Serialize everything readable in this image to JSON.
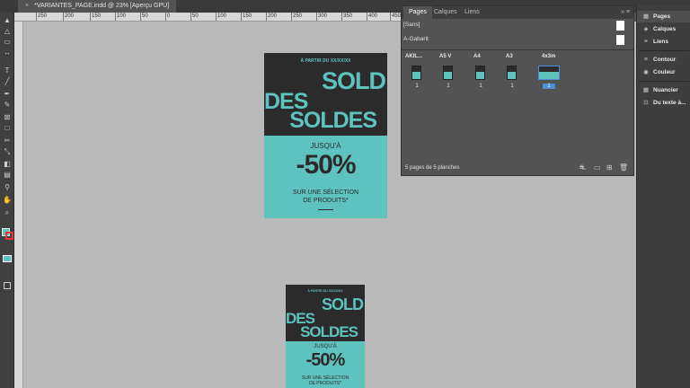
{
  "document_tab": {
    "close": "×",
    "title": "*VARIANTES_PAGE.indd @ 23% [Aperçu GPU]"
  },
  "ruler_ticks": [
    "250",
    "200",
    "150",
    "100",
    "50",
    "0",
    "50",
    "100",
    "150",
    "200",
    "250",
    "300",
    "350",
    "400",
    "450"
  ],
  "tools": [
    {
      "name": "selection-tool",
      "glyph": "▲"
    },
    {
      "name": "direct-selection-tool",
      "glyph": "△"
    },
    {
      "name": "page-tool",
      "glyph": "▭"
    },
    {
      "name": "gap-tool",
      "glyph": "↔"
    },
    {
      "name": "type-tool",
      "glyph": "T"
    },
    {
      "name": "line-tool",
      "glyph": "╱"
    },
    {
      "name": "pen-tool",
      "glyph": "✒"
    },
    {
      "name": "pencil-tool",
      "glyph": "✎"
    },
    {
      "name": "rectangle-frame-tool",
      "glyph": "⊠"
    },
    {
      "name": "rectangle-tool",
      "glyph": "□"
    },
    {
      "name": "scissors-tool",
      "glyph": "✂"
    },
    {
      "name": "free-transform-tool",
      "glyph": "⤡"
    },
    {
      "name": "gradient-tool",
      "glyph": "◧"
    },
    {
      "name": "note-tool",
      "glyph": "▤"
    },
    {
      "name": "eyedropper-tool",
      "glyph": "⚲"
    },
    {
      "name": "hand-tool",
      "glyph": "✋"
    },
    {
      "name": "zoom-tool",
      "glyph": "⌕"
    }
  ],
  "flyer_large": {
    "top_text": "À PARTIR DU XX/XX/XX",
    "sold": "SOLD",
    "des": "DES",
    "soldes": "SOLDES",
    "jusqua": "JUSQU'À",
    "discount": "-50%",
    "desc1": "SUR UNE SÉLECTION",
    "desc2": "DE PRODUITS*"
  },
  "flyer_small": {
    "top_text": "À PARTIR DU XX/XX/XX",
    "sold": "SOLD",
    "des": "DES",
    "soldes": "SOLDES",
    "jusqua": "JUSQU'À",
    "discount": "-50%",
    "desc1": "SUR UNE SÉLECTION",
    "desc2": "DE PRODUITS*"
  },
  "pages_panel": {
    "tabs": [
      "Pages",
      "Calques",
      "Liens"
    ],
    "menu": "» ≡",
    "masters": [
      "[Sans]",
      "A-Gabarit"
    ],
    "columns": [
      "AKIL...",
      "A5 V",
      "A4",
      "A3",
      "4x3m"
    ],
    "page_numbers": [
      "1",
      "1",
      "1",
      "1",
      "1"
    ],
    "footer": "5 pages de 5 planches",
    "footer_icons": [
      "⛐",
      "▭",
      "⊞",
      "🗑"
    ]
  },
  "dock": [
    {
      "label": "Pages",
      "icon": "▦"
    },
    {
      "label": "Calques",
      "icon": "◈"
    },
    {
      "label": "Liens",
      "icon": "⚭"
    },
    {
      "label": "Contour",
      "icon": "≡"
    },
    {
      "label": "Couleur",
      "icon": "◉"
    },
    {
      "label": "Nuancier",
      "icon": "▦"
    },
    {
      "label": "Du texte à...",
      "icon": "⊡"
    }
  ],
  "colors": {
    "accent": "#5ec2be",
    "dark": "#2b2b2b",
    "pasteboard": "#b9b9b9"
  }
}
